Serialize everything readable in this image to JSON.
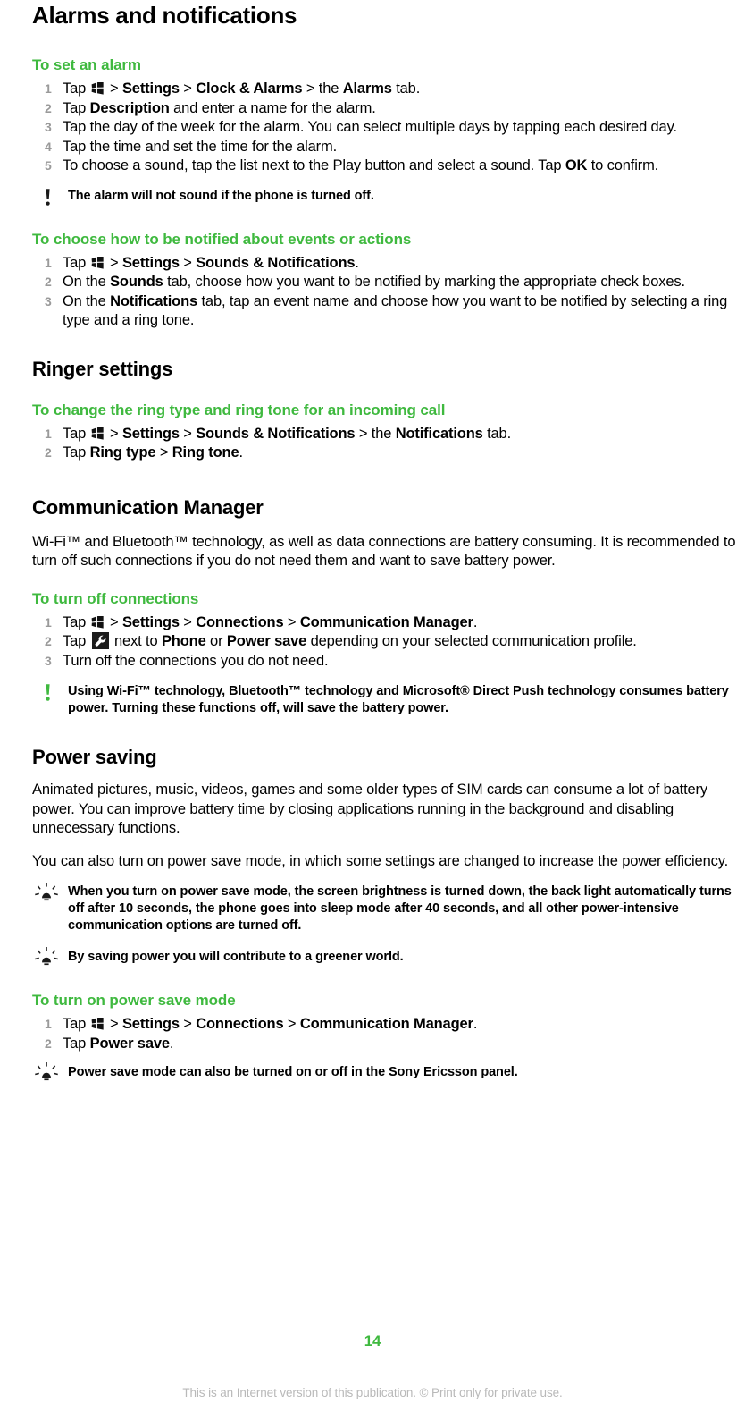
{
  "page": {
    "number": "14",
    "footer": "This is an Internet version of this publication. © Print only for private use.",
    "accent_green": "#3fb93f",
    "text_color": "#000000",
    "footer_color": "#b9b9b9"
  },
  "title": "Alarms and notifications",
  "sections": [
    {
      "id": "to-set-an-alarm",
      "heading": "To set an alarm",
      "steps": [
        {
          "parts": [
            {
              "t": "Tap ",
              "s": "plain"
            },
            {
              "t": "windows-start-icon",
              "s": "icon"
            },
            {
              "t": " > ",
              "s": "plain"
            },
            {
              "t": "Settings",
              "s": "bold"
            },
            {
              "t": " > ",
              "s": "plain"
            },
            {
              "t": "Clock & Alarms",
              "s": "bold"
            },
            {
              "t": " > the ",
              "s": "plain"
            },
            {
              "t": "Alarms",
              "s": "bold"
            },
            {
              "t": " tab.",
              "s": "plain"
            }
          ]
        },
        {
          "parts": [
            {
              "t": "Tap ",
              "s": "plain"
            },
            {
              "t": "Description",
              "s": "bold"
            },
            {
              "t": " and enter a name for the alarm.",
              "s": "plain"
            }
          ]
        },
        {
          "parts": [
            {
              "t": "Tap the day of the week for the alarm. You can select multiple days by tapping each desired day.",
              "s": "plain"
            }
          ]
        },
        {
          "parts": [
            {
              "t": "Tap the time and set the time for the alarm.",
              "s": "plain"
            }
          ]
        },
        {
          "parts": [
            {
              "t": "To choose a sound, tap the list next to the Play button and select a sound. Tap ",
              "s": "plain"
            },
            {
              "t": "OK",
              "s": "bold"
            },
            {
              "t": " to confirm.",
              "s": "plain"
            }
          ]
        }
      ],
      "callout": {
        "icon": "exclamation-icon",
        "icon_color": "#1a1a1a",
        "text": "The alarm will not sound if the phone is turned off."
      }
    },
    {
      "id": "to-choose-how-to-be-notified",
      "heading": "To choose how to be notified about events or actions",
      "steps": [
        {
          "parts": [
            {
              "t": "Tap ",
              "s": "plain"
            },
            {
              "t": "windows-start-icon",
              "s": "icon"
            },
            {
              "t": " > ",
              "s": "plain"
            },
            {
              "t": "Settings",
              "s": "bold"
            },
            {
              "t": " > ",
              "s": "plain"
            },
            {
              "t": "Sounds & Notifications",
              "s": "bold"
            },
            {
              "t": ".",
              "s": "plain"
            }
          ]
        },
        {
          "parts": [
            {
              "t": "On the ",
              "s": "plain"
            },
            {
              "t": "Sounds",
              "s": "bold"
            },
            {
              "t": " tab, choose how you want to be notified by marking the appropriate check boxes.",
              "s": "plain"
            }
          ]
        },
        {
          "parts": [
            {
              "t": "On the ",
              "s": "plain"
            },
            {
              "t": "Notifications",
              "s": "bold"
            },
            {
              "t": " tab, tap an event name and choose how you want to be notified by selecting a ring type and a ring tone.",
              "s": "plain"
            }
          ]
        }
      ]
    }
  ],
  "ringer": {
    "heading": "Ringer settings",
    "sub_heading": "To change the ring type and ring tone for an incoming call",
    "steps": [
      {
        "parts": [
          {
            "t": "Tap ",
            "s": "plain"
          },
          {
            "t": "windows-start-icon",
            "s": "icon"
          },
          {
            "t": " > ",
            "s": "plain"
          },
          {
            "t": "Settings",
            "s": "bold"
          },
          {
            "t": " > ",
            "s": "plain"
          },
          {
            "t": "Sounds & Notifications",
            "s": "bold"
          },
          {
            "t": " > the ",
            "s": "plain"
          },
          {
            "t": "Notifications",
            "s": "bold"
          },
          {
            "t": " tab.",
            "s": "plain"
          }
        ]
      },
      {
        "parts": [
          {
            "t": "Tap ",
            "s": "plain"
          },
          {
            "t": "Ring type",
            "s": "bold"
          },
          {
            "t": " > ",
            "s": "plain"
          },
          {
            "t": "Ring tone",
            "s": "bold"
          },
          {
            "t": ".",
            "s": "plain"
          }
        ]
      }
    ]
  },
  "comm_manager": {
    "heading": "Communication Manager",
    "intro": "Wi-Fi™ and Bluetooth™ technology, as well as data connections are battery consuming. It is recommended to turn off such connections if you do not need them and want to save battery power.",
    "sub_heading": "To turn off connections",
    "steps": [
      {
        "parts": [
          {
            "t": "Tap ",
            "s": "plain"
          },
          {
            "t": "windows-start-icon",
            "s": "icon"
          },
          {
            "t": " > ",
            "s": "plain"
          },
          {
            "t": "Settings",
            "s": "bold"
          },
          {
            "t": " > ",
            "s": "plain"
          },
          {
            "t": "Connections",
            "s": "bold"
          },
          {
            "t": " > ",
            "s": "plain"
          },
          {
            "t": "Communication Manager",
            "s": "bold"
          },
          {
            "t": ".",
            "s": "plain"
          }
        ]
      },
      {
        "parts": [
          {
            "t": "Tap ",
            "s": "plain"
          },
          {
            "t": "wrench-icon",
            "s": "icon2"
          },
          {
            "t": " next to ",
            "s": "plain"
          },
          {
            "t": "Phone",
            "s": "bold"
          },
          {
            "t": " or ",
            "s": "plain"
          },
          {
            "t": "Power save",
            "s": "bold"
          },
          {
            "t": " depending on your selected communication profile.",
            "s": "plain"
          }
        ]
      },
      {
        "parts": [
          {
            "t": "Turn off the connections you do not need.",
            "s": "plain"
          }
        ]
      }
    ],
    "callout": {
      "icon": "exclamation-icon",
      "icon_color": "#3fb93f",
      "text": "Using Wi-Fi™ technology, Bluetooth™ technology and Microsoft® Direct Push technology consumes battery power. Turning these functions off, will save the battery power."
    }
  },
  "power_saving": {
    "heading": "Power saving",
    "paragraph_1": "Animated pictures, music, videos, games and some older types of SIM cards can consume a lot of battery power. You can improve battery time by closing applications running in the background and disabling unnecessary functions.",
    "paragraph_2": "You can also turn on power save mode, in which some settings are changed to increase the power efficiency.",
    "tip_1": {
      "icon": "lightbulb-icon",
      "text": "When you turn on power save mode, the screen brightness is turned down, the back light automatically turns off after 10 seconds, the phone goes into sleep mode after 40 seconds, and all other power-intensive communication options are turned off."
    },
    "tip_2": {
      "icon": "lightbulb-icon",
      "text": "By saving power you will contribute to a greener world."
    },
    "sub_heading": "To turn on power save mode",
    "steps": [
      {
        "parts": [
          {
            "t": "Tap ",
            "s": "plain"
          },
          {
            "t": "windows-start-icon",
            "s": "icon"
          },
          {
            "t": " > ",
            "s": "plain"
          },
          {
            "t": "Settings",
            "s": "bold"
          },
          {
            "t": " > ",
            "s": "plain"
          },
          {
            "t": "Connections",
            "s": "bold"
          },
          {
            "t": " > ",
            "s": "plain"
          },
          {
            "t": "Communication Manager",
            "s": "bold"
          },
          {
            "t": ".",
            "s": "plain"
          }
        ]
      },
      {
        "parts": [
          {
            "t": "Tap ",
            "s": "plain"
          },
          {
            "t": "Power save",
            "s": "bold"
          },
          {
            "t": ".",
            "s": "plain"
          }
        ]
      }
    ],
    "tip_3": {
      "icon": "lightbulb-icon",
      "text": "Power save mode can also be turned on or off in the Sony Ericsson panel."
    }
  }
}
